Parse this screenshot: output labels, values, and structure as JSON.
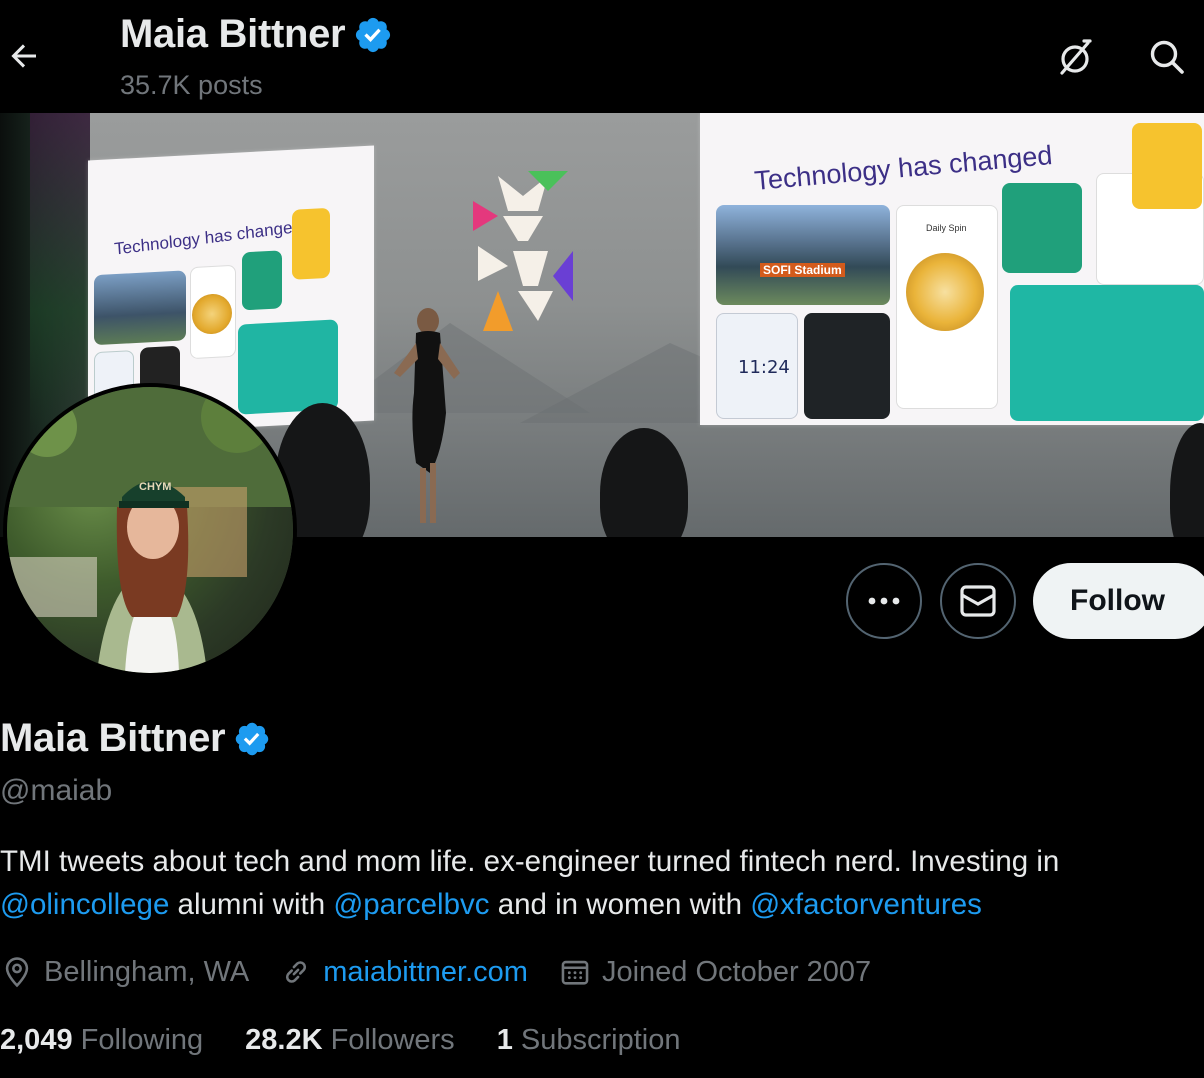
{
  "header": {
    "name": "Maia Bittner",
    "posts": "35.7K posts"
  },
  "banner": {
    "slide_left_title": "Technology has changed",
    "slide_right_title": "Technology has changed",
    "stadium_label": "SOFI Stadium",
    "daily_spin": "Daily Spin",
    "phone_time": "11:24"
  },
  "avatar": {
    "hat_text": "CHYM"
  },
  "actions": {
    "follow_label": "Follow"
  },
  "profile": {
    "name": "Maia Bittner",
    "handle": "@maiab",
    "bio": {
      "line1": "TMI tweets about tech and mom life. ex-engineer turned fintech nerd. Investing in",
      "mention1": "@olincollege",
      "text2": " alumni with ",
      "mention2": "@parcelbvc",
      "text3": " and in women with ",
      "mention3": "@xfactorventures"
    },
    "location": "Bellingham, WA",
    "website": "maiabittner.com",
    "joined": "Joined October 2007"
  },
  "stats": {
    "following_count": "2,049",
    "following_label": "Following",
    "followers_count": "28.2K",
    "followers_label": "Followers",
    "subscription_count": "1",
    "subscription_label": "Subscription"
  },
  "colors": {
    "accent": "#1d9bf0",
    "secondary_text": "#71767b",
    "primary_text": "#e7e9ea",
    "background": "#000000",
    "verified": "#1d9bf0"
  },
  "icons": [
    "back-arrow-icon",
    "verified-badge-icon",
    "no-signal-icon",
    "search-icon",
    "more-icon",
    "mail-icon",
    "location-icon",
    "link-icon",
    "calendar-icon"
  ]
}
